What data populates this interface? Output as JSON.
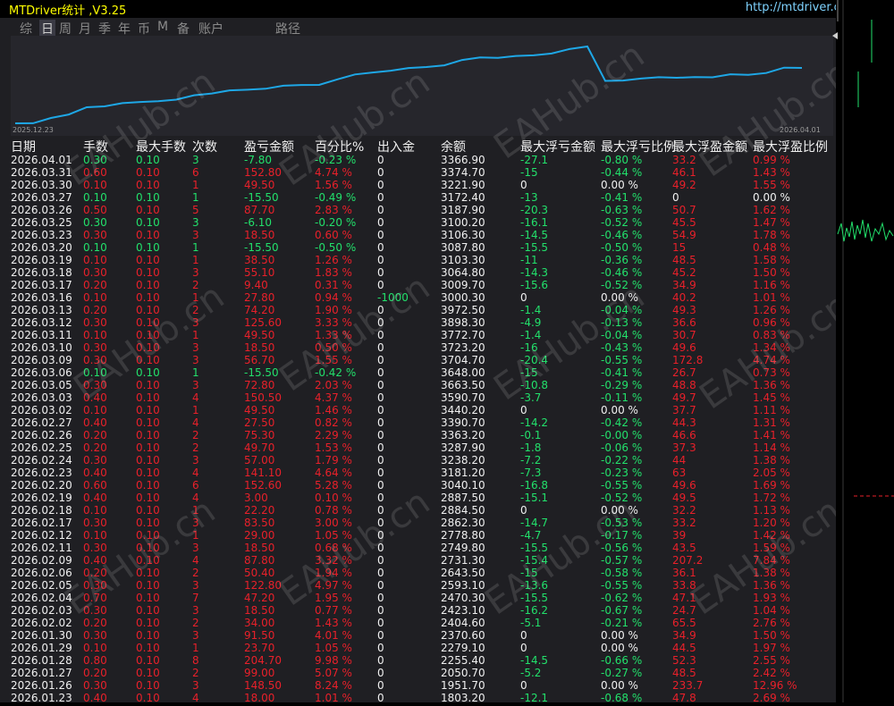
{
  "app": {
    "title": "MTDriver统计 ,V3.25",
    "site": "http://mtdriver.cn"
  },
  "menu": [
    {
      "label": "综",
      "active": false
    },
    {
      "label": "日",
      "active": true
    },
    {
      "label": "周",
      "active": false
    },
    {
      "label": "月",
      "active": false
    },
    {
      "label": "季",
      "active": false
    },
    {
      "label": "年",
      "active": false
    },
    {
      "label": "币",
      "active": false
    },
    {
      "label": "M",
      "active": false
    },
    {
      "label": "备",
      "active": false
    },
    {
      "label": "账户",
      "active": false
    },
    {
      "label": "路径",
      "active": false
    }
  ],
  "chart": {
    "start_date": "2025.12.23",
    "end_date": "2026.04.01",
    "line_color": "#1ea7e6"
  },
  "columns": [
    "日期",
    "手数",
    "最大手数",
    "次数",
    "盈亏金额",
    "百分比%",
    "出入金",
    "余额",
    "最大浮亏金额",
    "最大浮亏比例",
    "最大浮盈金额",
    "最大浮盈比例"
  ],
  "colors": {
    "gain": "#22e06b",
    "loss": "#e8202a",
    "neutral": "#f0f0f0",
    "cyan": "#1ea7e6"
  },
  "rows": [
    {
      "date": "2026.04.01",
      "lots": "0.30",
      "max_lots": "0.10",
      "count": "3",
      "pnl": "-7.80",
      "pct": "-0.23 %",
      "flow": "0",
      "bal": "3366.90",
      "ddv": "-27.1",
      "ddp": "-0.80 %",
      "fpv": "33.2",
      "fpp": "0.99 %",
      "c": "g",
      "dc": "g",
      "fc": "r"
    },
    {
      "date": "2026.03.31",
      "lots": "0.60",
      "max_lots": "0.10",
      "count": "6",
      "pnl": "152.80",
      "pct": "4.74 %",
      "flow": "0",
      "bal": "3374.70",
      "ddv": "-15",
      "ddp": "-0.44 %",
      "fpv": "46.1",
      "fpp": "1.43 %",
      "c": "r",
      "dc": "g",
      "fc": "r"
    },
    {
      "date": "2026.03.30",
      "lots": "0.10",
      "max_lots": "0.10",
      "count": "1",
      "pnl": "49.50",
      "pct": "1.56 %",
      "flow": "0",
      "bal": "3221.90",
      "ddv": "0",
      "ddp": "0.00 %",
      "fpv": "49.2",
      "fpp": "1.55 %",
      "c": "r",
      "dc": "w",
      "fc": "r"
    },
    {
      "date": "2026.03.27",
      "lots": "0.10",
      "max_lots": "0.10",
      "count": "1",
      "pnl": "-15.50",
      "pct": "-0.49 %",
      "flow": "0",
      "bal": "3172.40",
      "ddv": "-13",
      "ddp": "-0.41 %",
      "fpv": "0",
      "fpp": "0.00 %",
      "c": "g",
      "dc": "g",
      "fc": "w"
    },
    {
      "date": "2026.03.26",
      "lots": "0.50",
      "max_lots": "0.10",
      "count": "5",
      "pnl": "87.70",
      "pct": "2.83 %",
      "flow": "0",
      "bal": "3187.90",
      "ddv": "-20.3",
      "ddp": "-0.63 %",
      "fpv": "50.7",
      "fpp": "1.62 %",
      "c": "r",
      "dc": "g",
      "fc": "r"
    },
    {
      "date": "2026.03.25",
      "lots": "0.30",
      "max_lots": "0.10",
      "count": "3",
      "pnl": "-6.10",
      "pct": "-0.20 %",
      "flow": "0",
      "bal": "3100.20",
      "ddv": "-16.1",
      "ddp": "-0.52 %",
      "fpv": "45.5",
      "fpp": "1.47 %",
      "c": "g",
      "dc": "g",
      "fc": "r"
    },
    {
      "date": "2026.03.23",
      "lots": "0.30",
      "max_lots": "0.10",
      "count": "3",
      "pnl": "18.50",
      "pct": "0.60 %",
      "flow": "0",
      "bal": "3106.30",
      "ddv": "-14.5",
      "ddp": "-0.46 %",
      "fpv": "54.9",
      "fpp": "1.78 %",
      "c": "r",
      "dc": "g",
      "fc": "r"
    },
    {
      "date": "2026.03.20",
      "lots": "0.10",
      "max_lots": "0.10",
      "count": "1",
      "pnl": "-15.50",
      "pct": "-0.50 %",
      "flow": "0",
      "bal": "3087.80",
      "ddv": "-15.5",
      "ddp": "-0.50 %",
      "fpv": "15",
      "fpp": "0.48 %",
      "c": "g",
      "dc": "g",
      "fc": "r"
    },
    {
      "date": "2026.03.19",
      "lots": "0.10",
      "max_lots": "0.10",
      "count": "1",
      "pnl": "38.50",
      "pct": "1.26 %",
      "flow": "0",
      "bal": "3103.30",
      "ddv": "-11",
      "ddp": "-0.36 %",
      "fpv": "48.5",
      "fpp": "1.58 %",
      "c": "r",
      "dc": "g",
      "fc": "r"
    },
    {
      "date": "2026.03.18",
      "lots": "0.30",
      "max_lots": "0.10",
      "count": "3",
      "pnl": "55.10",
      "pct": "1.83 %",
      "flow": "0",
      "bal": "3064.80",
      "ddv": "-14.3",
      "ddp": "-0.46 %",
      "fpv": "45.2",
      "fpp": "1.50 %",
      "c": "r",
      "dc": "g",
      "fc": "r"
    },
    {
      "date": "2026.03.17",
      "lots": "0.20",
      "max_lots": "0.10",
      "count": "2",
      "pnl": "9.40",
      "pct": "0.31 %",
      "flow": "0",
      "bal": "3009.70",
      "ddv": "-15.6",
      "ddp": "-0.52 %",
      "fpv": "34.9",
      "fpp": "1.16 %",
      "c": "r",
      "dc": "g",
      "fc": "r"
    },
    {
      "date": "2026.03.16",
      "lots": "0.10",
      "max_lots": "0.10",
      "count": "1",
      "pnl": "27.80",
      "pct": "0.94 %",
      "flow": "-1000",
      "bal": "3000.30",
      "ddv": "0",
      "ddp": "0.00 %",
      "fpv": "40.2",
      "fpp": "1.01 %",
      "c": "r",
      "dc": "w",
      "fc": "r",
      "flowc": "g"
    },
    {
      "date": "2026.03.13",
      "lots": "0.20",
      "max_lots": "0.10",
      "count": "2",
      "pnl": "74.20",
      "pct": "1.90 %",
      "flow": "0",
      "bal": "3972.50",
      "ddv": "-1.4",
      "ddp": "-0.04 %",
      "fpv": "49.3",
      "fpp": "1.26 %",
      "c": "r",
      "dc": "g",
      "fc": "r"
    },
    {
      "date": "2026.03.12",
      "lots": "0.30",
      "max_lots": "0.10",
      "count": "3",
      "pnl": "125.60",
      "pct": "3.33 %",
      "flow": "0",
      "bal": "3898.30",
      "ddv": "-4.9",
      "ddp": "-0.13 %",
      "fpv": "36.6",
      "fpp": "0.96 %",
      "c": "r",
      "dc": "g",
      "fc": "r"
    },
    {
      "date": "2026.03.11",
      "lots": "0.10",
      "max_lots": "0.10",
      "count": "1",
      "pnl": "49.50",
      "pct": "1.33 %",
      "flow": "0",
      "bal": "3772.70",
      "ddv": "-1.4",
      "ddp": "-0.04 %",
      "fpv": "30.7",
      "fpp": "0.83 %",
      "c": "r",
      "dc": "g",
      "fc": "r"
    },
    {
      "date": "2026.03.10",
      "lots": "0.30",
      "max_lots": "0.10",
      "count": "3",
      "pnl": "18.50",
      "pct": "0.50 %",
      "flow": "0",
      "bal": "3723.20",
      "ddv": "-16",
      "ddp": "-0.43 %",
      "fpv": "49.6",
      "fpp": "1.34 %",
      "c": "r",
      "dc": "g",
      "fc": "r"
    },
    {
      "date": "2026.03.09",
      "lots": "0.30",
      "max_lots": "0.10",
      "count": "3",
      "pnl": "56.70",
      "pct": "1.55 %",
      "flow": "0",
      "bal": "3704.70",
      "ddv": "-20.4",
      "ddp": "-0.55 %",
      "fpv": "172.8",
      "fpp": "4.74 %",
      "c": "r",
      "dc": "g",
      "fc": "r"
    },
    {
      "date": "2026.03.06",
      "lots": "0.10",
      "max_lots": "0.10",
      "count": "1",
      "pnl": "-15.50",
      "pct": "-0.42 %",
      "flow": "0",
      "bal": "3648.00",
      "ddv": "-15",
      "ddp": "-0.41 %",
      "fpv": "26.7",
      "fpp": "0.73 %",
      "c": "g",
      "dc": "g",
      "fc": "r"
    },
    {
      "date": "2026.03.05",
      "lots": "0.30",
      "max_lots": "0.10",
      "count": "3",
      "pnl": "72.80",
      "pct": "2.03 %",
      "flow": "0",
      "bal": "3663.50",
      "ddv": "-10.8",
      "ddp": "-0.29 %",
      "fpv": "48.8",
      "fpp": "1.36 %",
      "c": "r",
      "dc": "g",
      "fc": "r"
    },
    {
      "date": "2026.03.03",
      "lots": "0.40",
      "max_lots": "0.10",
      "count": "4",
      "pnl": "150.50",
      "pct": "4.37 %",
      "flow": "0",
      "bal": "3590.70",
      "ddv": "-3.7",
      "ddp": "-0.11 %",
      "fpv": "49.7",
      "fpp": "1.45 %",
      "c": "r",
      "dc": "g",
      "fc": "r"
    },
    {
      "date": "2026.03.02",
      "lots": "0.10",
      "max_lots": "0.10",
      "count": "1",
      "pnl": "49.50",
      "pct": "1.46 %",
      "flow": "0",
      "bal": "3440.20",
      "ddv": "0",
      "ddp": "0.00 %",
      "fpv": "37.7",
      "fpp": "1.11 %",
      "c": "r",
      "dc": "w",
      "fc": "r"
    },
    {
      "date": "2026.02.27",
      "lots": "0.40",
      "max_lots": "0.10",
      "count": "4",
      "pnl": "27.50",
      "pct": "0.82 %",
      "flow": "0",
      "bal": "3390.70",
      "ddv": "-14.2",
      "ddp": "-0.42 %",
      "fpv": "44.3",
      "fpp": "1.31 %",
      "c": "r",
      "dc": "g",
      "fc": "r"
    },
    {
      "date": "2026.02.26",
      "lots": "0.20",
      "max_lots": "0.10",
      "count": "2",
      "pnl": "75.30",
      "pct": "2.29 %",
      "flow": "0",
      "bal": "3363.20",
      "ddv": "-0.1",
      "ddp": "-0.00 %",
      "fpv": "46.6",
      "fpp": "1.41 %",
      "c": "r",
      "dc": "g",
      "fc": "r"
    },
    {
      "date": "2026.02.25",
      "lots": "0.20",
      "max_lots": "0.10",
      "count": "2",
      "pnl": "49.70",
      "pct": "1.53 %",
      "flow": "0",
      "bal": "3287.90",
      "ddv": "-1.8",
      "ddp": "-0.06 %",
      "fpv": "37.3",
      "fpp": "1.14 %",
      "c": "r",
      "dc": "g",
      "fc": "r"
    },
    {
      "date": "2026.02.24",
      "lots": "0.30",
      "max_lots": "0.10",
      "count": "3",
      "pnl": "57.00",
      "pct": "1.79 %",
      "flow": "0",
      "bal": "3238.20",
      "ddv": "-7.2",
      "ddp": "-0.22 %",
      "fpv": "44",
      "fpp": "1.38 %",
      "c": "r",
      "dc": "g",
      "fc": "r"
    },
    {
      "date": "2026.02.23",
      "lots": "0.40",
      "max_lots": "0.10",
      "count": "4",
      "pnl": "141.10",
      "pct": "4.64 %",
      "flow": "0",
      "bal": "3181.20",
      "ddv": "-7.3",
      "ddp": "-0.23 %",
      "fpv": "63",
      "fpp": "2.05 %",
      "c": "r",
      "dc": "g",
      "fc": "r"
    },
    {
      "date": "2026.02.20",
      "lots": "0.60",
      "max_lots": "0.10",
      "count": "6",
      "pnl": "152.60",
      "pct": "5.28 %",
      "flow": "0",
      "bal": "3040.10",
      "ddv": "-16.8",
      "ddp": "-0.55 %",
      "fpv": "49.6",
      "fpp": "1.69 %",
      "c": "r",
      "dc": "g",
      "fc": "r"
    },
    {
      "date": "2026.02.19",
      "lots": "0.40",
      "max_lots": "0.10",
      "count": "4",
      "pnl": "3.00",
      "pct": "0.10 %",
      "flow": "0",
      "bal": "2887.50",
      "ddv": "-15.1",
      "ddp": "-0.52 %",
      "fpv": "49.5",
      "fpp": "1.72 %",
      "c": "r",
      "dc": "g",
      "fc": "r"
    },
    {
      "date": "2026.02.18",
      "lots": "0.10",
      "max_lots": "0.10",
      "count": "1",
      "pnl": "22.20",
      "pct": "0.78 %",
      "flow": "0",
      "bal": "2884.50",
      "ddv": "0",
      "ddp": "0.00 %",
      "fpv": "32.2",
      "fpp": "1.13 %",
      "c": "r",
      "dc": "w",
      "fc": "r"
    },
    {
      "date": "2026.02.17",
      "lots": "0.30",
      "max_lots": "0.10",
      "count": "3",
      "pnl": "83.50",
      "pct": "3.00 %",
      "flow": "0",
      "bal": "2862.30",
      "ddv": "-14.7",
      "ddp": "-0.53 %",
      "fpv": "33.2",
      "fpp": "1.20 %",
      "c": "r",
      "dc": "g",
      "fc": "r"
    },
    {
      "date": "2026.02.12",
      "lots": "0.10",
      "max_lots": "0.10",
      "count": "1",
      "pnl": "29.00",
      "pct": "1.05 %",
      "flow": "0",
      "bal": "2778.80",
      "ddv": "-4.7",
      "ddp": "-0.17 %",
      "fpv": "39",
      "fpp": "1.42 %",
      "c": "r",
      "dc": "g",
      "fc": "r"
    },
    {
      "date": "2026.02.11",
      "lots": "0.30",
      "max_lots": "0.10",
      "count": "3",
      "pnl": "18.50",
      "pct": "0.68 %",
      "flow": "0",
      "bal": "2749.80",
      "ddv": "-15.5",
      "ddp": "-0.56 %",
      "fpv": "43.5",
      "fpp": "1.59 %",
      "c": "r",
      "dc": "g",
      "fc": "r"
    },
    {
      "date": "2026.02.09",
      "lots": "0.40",
      "max_lots": "0.10",
      "count": "4",
      "pnl": "87.80",
      "pct": "3.32 %",
      "flow": "0",
      "bal": "2731.30",
      "ddv": "-15.4",
      "ddp": "-0.57 %",
      "fpv": "207.2",
      "fpp": "7.84 %",
      "c": "r",
      "dc": "g",
      "fc": "r"
    },
    {
      "date": "2026.02.06",
      "lots": "0.20",
      "max_lots": "0.10",
      "count": "2",
      "pnl": "50.40",
      "pct": "1.94 %",
      "flow": "0",
      "bal": "2643.50",
      "ddv": "-15",
      "ddp": "-0.58 %",
      "fpv": "36.1",
      "fpp": "1.38 %",
      "c": "r",
      "dc": "g",
      "fc": "r"
    },
    {
      "date": "2026.02.05",
      "lots": "0.30",
      "max_lots": "0.10",
      "count": "3",
      "pnl": "122.80",
      "pct": "4.97 %",
      "flow": "0",
      "bal": "2593.10",
      "ddv": "-13.6",
      "ddp": "-0.55 %",
      "fpv": "33.8",
      "fpp": "1.36 %",
      "c": "r",
      "dc": "g",
      "fc": "r"
    },
    {
      "date": "2026.02.04",
      "lots": "0.70",
      "max_lots": "0.10",
      "count": "7",
      "pnl": "47.20",
      "pct": "1.95 %",
      "flow": "0",
      "bal": "2470.30",
      "ddv": "-15.5",
      "ddp": "-0.62 %",
      "fpv": "47.1",
      "fpp": "1.93 %",
      "c": "r",
      "dc": "g",
      "fc": "r"
    },
    {
      "date": "2026.02.03",
      "lots": "0.30",
      "max_lots": "0.10",
      "count": "3",
      "pnl": "18.50",
      "pct": "0.77 %",
      "flow": "0",
      "bal": "2423.10",
      "ddv": "-16.2",
      "ddp": "-0.67 %",
      "fpv": "24.7",
      "fpp": "1.04 %",
      "c": "r",
      "dc": "g",
      "fc": "r"
    },
    {
      "date": "2026.02.02",
      "lots": "0.20",
      "max_lots": "0.10",
      "count": "2",
      "pnl": "34.00",
      "pct": "1.43 %",
      "flow": "0",
      "bal": "2404.60",
      "ddv": "-5.1",
      "ddp": "-0.21 %",
      "fpv": "65.5",
      "fpp": "2.76 %",
      "c": "r",
      "dc": "g",
      "fc": "r"
    },
    {
      "date": "2026.01.30",
      "lots": "0.30",
      "max_lots": "0.10",
      "count": "3",
      "pnl": "91.50",
      "pct": "4.01 %",
      "flow": "0",
      "bal": "2370.60",
      "ddv": "0",
      "ddp": "0.00 %",
      "fpv": "34.9",
      "fpp": "1.50 %",
      "c": "r",
      "dc": "w",
      "fc": "r"
    },
    {
      "date": "2026.01.29",
      "lots": "0.10",
      "max_lots": "0.10",
      "count": "1",
      "pnl": "23.70",
      "pct": "1.05 %",
      "flow": "0",
      "bal": "2279.10",
      "ddv": "0",
      "ddp": "0.00 %",
      "fpv": "44.5",
      "fpp": "1.97 %",
      "c": "r",
      "dc": "w",
      "fc": "r"
    },
    {
      "date": "2026.01.28",
      "lots": "0.80",
      "max_lots": "0.10",
      "count": "8",
      "pnl": "204.70",
      "pct": "9.98 %",
      "flow": "0",
      "bal": "2255.40",
      "ddv": "-14.5",
      "ddp": "-0.66 %",
      "fpv": "52.3",
      "fpp": "2.55 %",
      "c": "r",
      "dc": "g",
      "fc": "r"
    },
    {
      "date": "2026.01.27",
      "lots": "0.20",
      "max_lots": "0.10",
      "count": "2",
      "pnl": "99.00",
      "pct": "5.07 %",
      "flow": "0",
      "bal": "2050.70",
      "ddv": "-5.2",
      "ddp": "-0.27 %",
      "fpv": "48.5",
      "fpp": "2.42 %",
      "c": "r",
      "dc": "g",
      "fc": "r"
    },
    {
      "date": "2026.01.26",
      "lots": "0.30",
      "max_lots": "0.10",
      "count": "3",
      "pnl": "148.50",
      "pct": "8.24 %",
      "flow": "0",
      "bal": "1951.70",
      "ddv": "0",
      "ddp": "0.00 %",
      "fpv": "233.7",
      "fpp": "12.96 %",
      "c": "r",
      "dc": "w",
      "fc": "r"
    },
    {
      "date": "2026.01.23",
      "lots": "0.40",
      "max_lots": "0.10",
      "count": "4",
      "pnl": "18.00",
      "pct": "1.01 %",
      "flow": "0",
      "bal": "1803.20",
      "ddv": "-12.1",
      "ddp": "-0.68 %",
      "fpv": "47.8",
      "fpp": "2.69 %",
      "c": "r",
      "dc": "g",
      "fc": "r"
    }
  ],
  "watermark": "EAHub.cn"
}
